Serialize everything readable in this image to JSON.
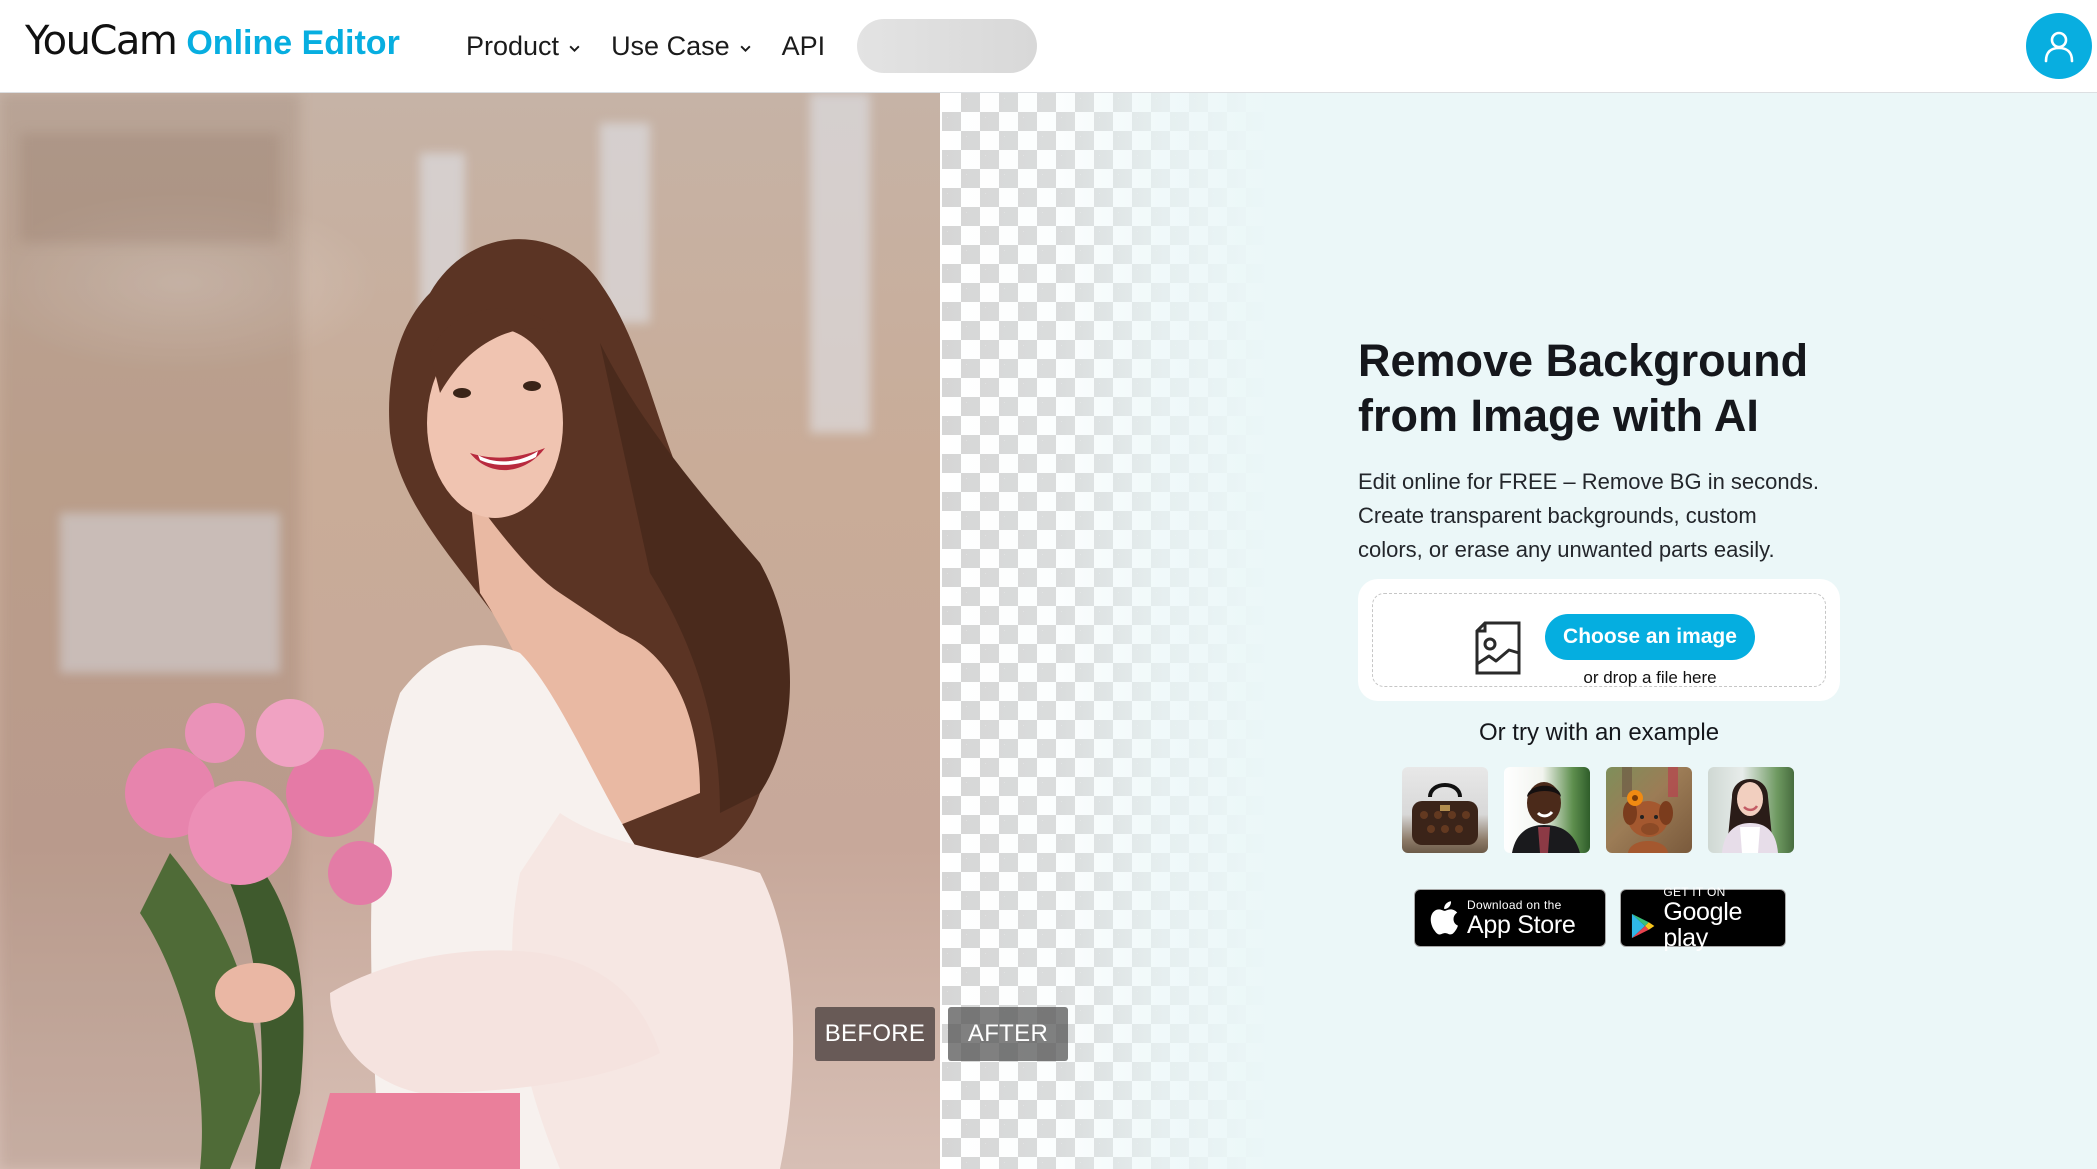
{
  "header": {
    "logo_main": "YouCam",
    "logo_sub": "Online Editor",
    "nav": [
      {
        "label": "Product",
        "has_dropdown": true
      },
      {
        "label": "Use Case",
        "has_dropdown": true
      },
      {
        "label": "API",
        "has_dropdown": false
      }
    ],
    "account_icon": "user-icon"
  },
  "compare": {
    "before_label": "BEFORE",
    "after_label": "AFTER"
  },
  "hero": {
    "title_line1": "Remove Background",
    "title_line2": "from Image with AI",
    "desc_line1": "Edit online for FREE – Remove BG in seconds.",
    "desc_line2": "Create transparent backgrounds, custom",
    "desc_line3": "colors, or erase any unwanted parts easily."
  },
  "upload": {
    "icon": "image-file-icon",
    "button_label": "Choose an image",
    "drop_text": "or drop a file here"
  },
  "examples": {
    "label": "Or try with an example",
    "items": [
      {
        "name": "handbag"
      },
      {
        "name": "man-portrait"
      },
      {
        "name": "puppy-with-flower"
      },
      {
        "name": "woman-portrait"
      }
    ]
  },
  "stores": {
    "apple_small": "Download on the",
    "apple_big": "App Store",
    "google_small": "GET IT ON",
    "google_big": "Google play"
  },
  "colors": {
    "brand": "#07aee0",
    "page_bg": "#ebf7f8",
    "text": "#15171c"
  }
}
